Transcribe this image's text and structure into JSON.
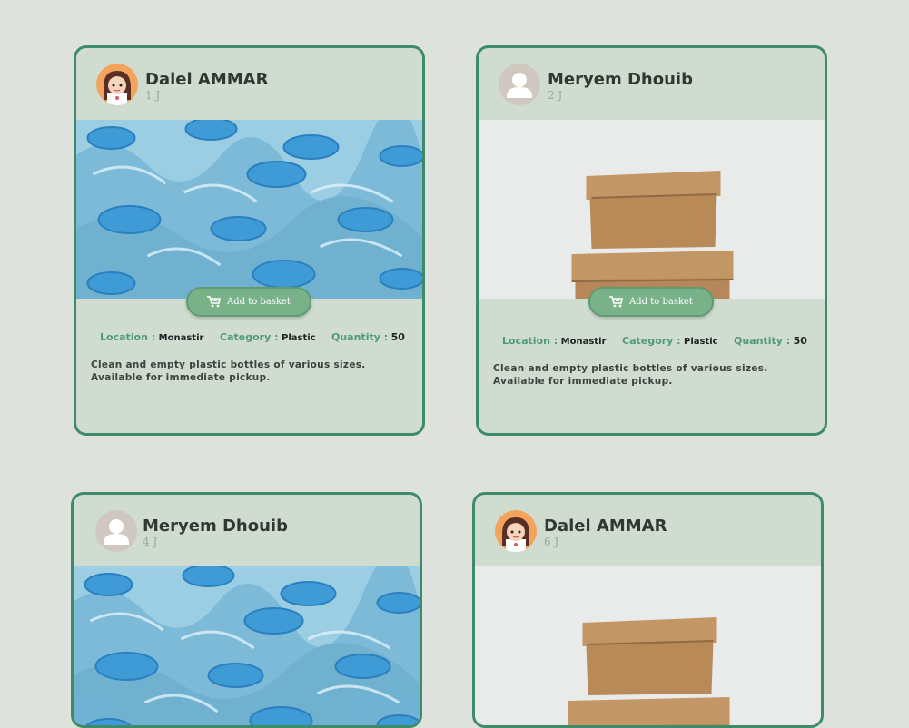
{
  "cards": [
    {
      "user": "Dalel AMMAR",
      "time": "1 J",
      "avatar": "girl-avatar",
      "image": "plastic-bottles-photo",
      "basket_label": "Add to basket",
      "location_label": "Location :",
      "location": "Monastir",
      "category_label": "Category :",
      "category": "Plastic",
      "quantity_label": "Quantity :",
      "quantity": "50",
      "description": "Clean and empty plastic bottles of various sizes. Available for immediate pickup."
    },
    {
      "user": "Meryem Dhouib",
      "time": "2 J",
      "avatar": "default-user-avatar",
      "image": "cardboard-boxes-photo",
      "basket_label": "Add to basket",
      "location_label": "Location :",
      "location": "Monastir",
      "category_label": "Category :",
      "category": "Plastic",
      "quantity_label": "Quantity :",
      "quantity": "50",
      "description": "Clean and empty plastic bottles of various sizes. Available for immediate pickup."
    },
    {
      "user": "Meryem Dhouib",
      "time": "4 J",
      "avatar": "default-user-avatar",
      "image": "plastic-bottles-photo"
    },
    {
      "user": "Dalel AMMAR",
      "time": "6 J",
      "avatar": "girl-avatar",
      "image": "cardboard-boxes-photo"
    }
  ],
  "colors": {
    "background": "#dde3dc",
    "card": "#cfdccf",
    "border": "#3f8a68",
    "button": "#79b288",
    "label": "#4f9a78"
  },
  "icons": {
    "basket": "shopping-cart-icon"
  }
}
